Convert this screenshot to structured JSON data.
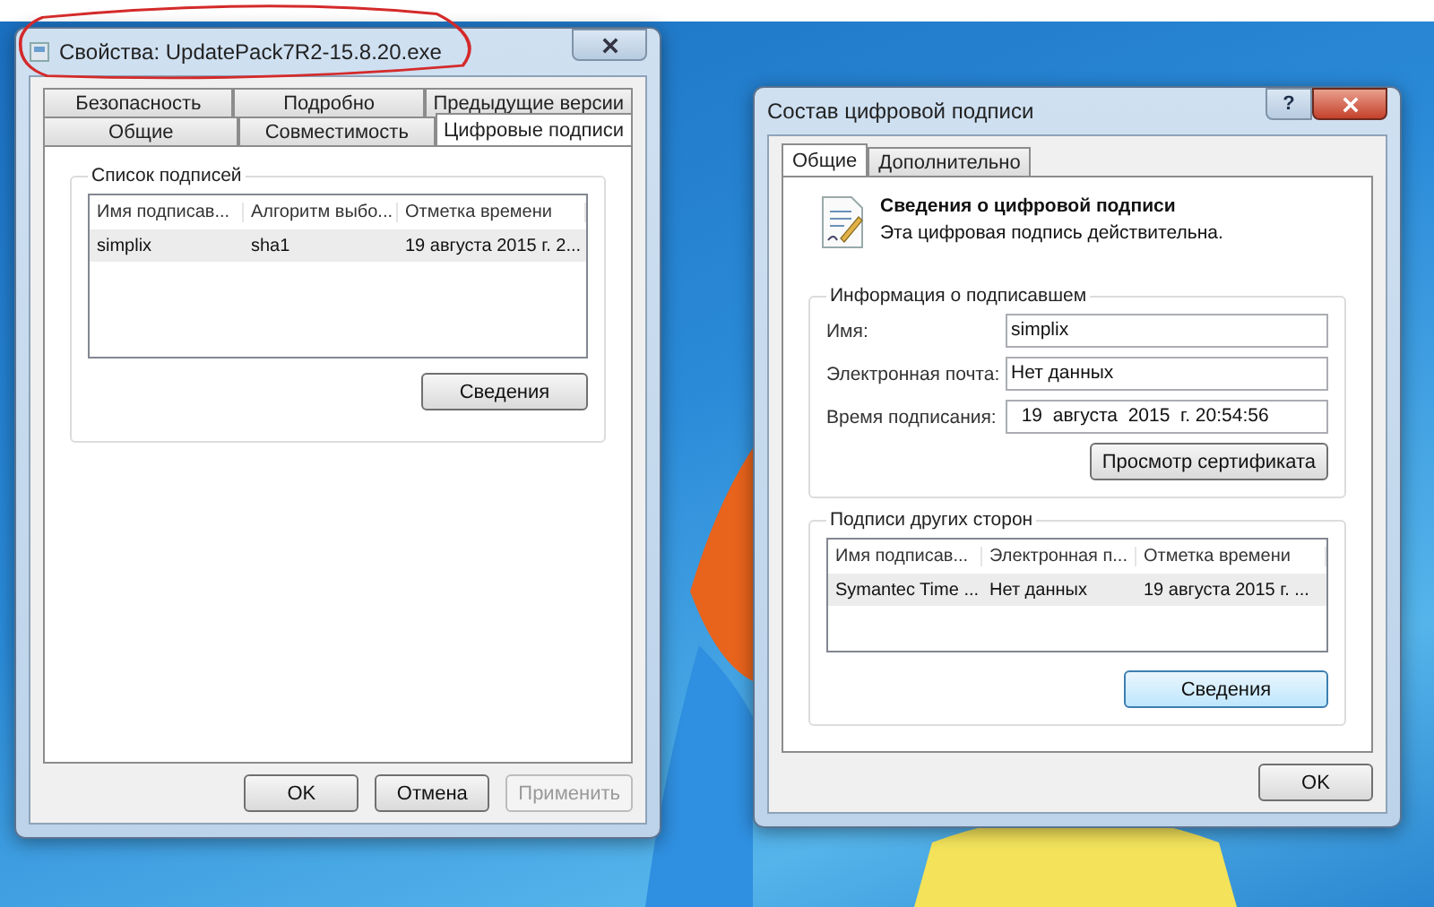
{
  "properties_window": {
    "title": "Свойства: UpdatePack7R2-15.8.20.exe",
    "tab_rows": [
      {
        "tabs": [
          {
            "label": "Безопасность",
            "selected": false
          },
          {
            "label": "Подробно",
            "selected": false
          },
          {
            "label": "Предыдущие версии",
            "selected": false
          }
        ]
      },
      {
        "tabs": [
          {
            "label": "Общие",
            "selected": false
          },
          {
            "label": "Совместимость",
            "selected": false
          },
          {
            "label": "Цифровые подписи",
            "selected": true
          }
        ]
      }
    ],
    "signature_group": {
      "title": "Список подписей",
      "columns": [
        "Имя подписав...",
        "Алгоритм выбо...",
        "Отметка времени"
      ],
      "rows": [
        {
          "cells": [
            "simplix",
            "sha1",
            "19 августа 2015 г. 2..."
          ],
          "selected": true
        }
      ],
      "details_button": {
        "label": "Сведения",
        "focused": false
      }
    },
    "buttons": [
      {
        "label": "OK",
        "disabled": false
      },
      {
        "label": "Отмена",
        "disabled": false
      },
      {
        "label": "Применить",
        "disabled": true
      }
    ]
  },
  "signature_window": {
    "title": "Состав цифровой подписи",
    "help_button": "?",
    "tabs": [
      {
        "label": "Общие",
        "selected": true
      },
      {
        "label": "Дополнительно",
        "selected": false
      }
    ],
    "header": {
      "title": "Сведения о цифровой подписи",
      "subtitle": "Эта цифровая подпись действительна."
    },
    "signer_group": {
      "title": "Информация о подписавшем",
      "fields": [
        {
          "label": "Имя:",
          "value": "simplix"
        },
        {
          "label": "Электронная почта:",
          "value": "Нет данных"
        },
        {
          "label": "Время подписания:",
          "value": "  19  августа  2015  г. 20:54:56"
        }
      ],
      "certificate_button": "Просмотр сертификата"
    },
    "countersignatures_group": {
      "title": "Подписи других сторон",
      "columns": [
        "Имя подписав...",
        "Электронная п...",
        "Отметка времени"
      ],
      "rows": [
        {
          "cells": [
            "Symantec Time ...",
            "Нет данных",
            "19 августа 2015 г. ..."
          ],
          "selected": true
        }
      ],
      "details_button": {
        "label": "Сведения",
        "focused": true
      }
    },
    "ok_button": "OK"
  }
}
